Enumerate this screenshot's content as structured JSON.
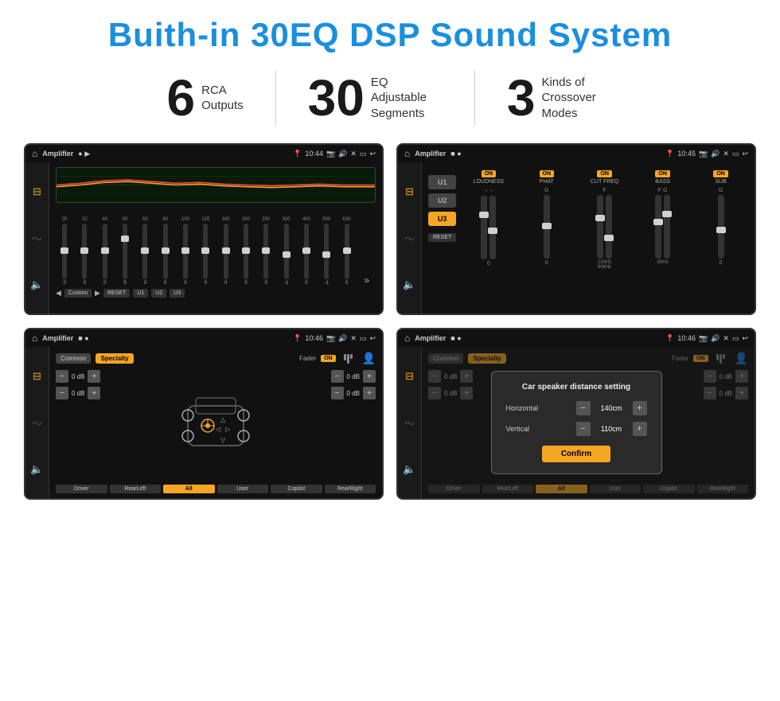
{
  "title": "Buith-in 30EQ DSP Sound System",
  "stats": [
    {
      "number": "6",
      "label": "RCA\nOutputs"
    },
    {
      "number": "30",
      "label": "EQ Adjustable\nSegments"
    },
    {
      "number": "3",
      "label": "Kinds of\nCrossover Modes"
    }
  ],
  "screens": [
    {
      "id": "eq-screen",
      "statusBar": {
        "app": "Amplifier",
        "time": "10:44",
        "icons": [
          "home",
          "play",
          "location",
          "camera",
          "volume",
          "close",
          "square",
          "back"
        ]
      },
      "type": "equalizer",
      "frequencies": [
        "25",
        "32",
        "40",
        "50",
        "63",
        "80",
        "100",
        "125",
        "160",
        "200",
        "250",
        "320",
        "400",
        "500",
        "630"
      ],
      "values": [
        "0",
        "0",
        "0",
        "5",
        "0",
        "0",
        "0",
        "0",
        "0",
        "0",
        "0",
        "-1",
        "0",
        "-1"
      ],
      "presets": [
        "Custom",
        "RESET",
        "U1",
        "U2",
        "U3"
      ]
    },
    {
      "id": "crossover-screen",
      "statusBar": {
        "app": "Amplifier",
        "time": "10:45"
      },
      "type": "crossover",
      "presets": [
        "U1",
        "U2",
        "U3"
      ],
      "activePreset": "U3",
      "sections": [
        {
          "label": "LOUDNESS",
          "on": true
        },
        {
          "label": "PHAT",
          "on": true
        },
        {
          "label": "CUT FREQ",
          "on": true
        },
        {
          "label": "BASS",
          "on": true
        },
        {
          "label": "SUB",
          "on": true
        }
      ],
      "resetLabel": "RESET"
    },
    {
      "id": "speaker-screen",
      "statusBar": {
        "app": "Amplifier",
        "time": "10:46"
      },
      "type": "speaker",
      "tabs": [
        "Common",
        "Specialty"
      ],
      "activeTab": "Specialty",
      "fader": {
        "label": "Fader",
        "on": true
      },
      "volumes": [
        "0 dB",
        "0 dB",
        "0 dB",
        "0 dB"
      ],
      "buttons": [
        "Driver",
        "RearLeft",
        "All",
        "User",
        "Copilot",
        "RearRight"
      ]
    },
    {
      "id": "dialog-screen",
      "statusBar": {
        "app": "Amplifier",
        "time": "10:46"
      },
      "type": "speaker-dialog",
      "dialog": {
        "title": "Car speaker distance setting",
        "horizontal": {
          "label": "Horizontal",
          "value": "140cm"
        },
        "vertical": {
          "label": "Vertical",
          "value": "110cm"
        },
        "confirmLabel": "Confirm"
      },
      "volumes": [
        "0 dB",
        "0 dB"
      ],
      "buttons": [
        "Driver",
        "RearLeft",
        "All",
        "User",
        "Copilot",
        "RearRight"
      ]
    }
  ]
}
